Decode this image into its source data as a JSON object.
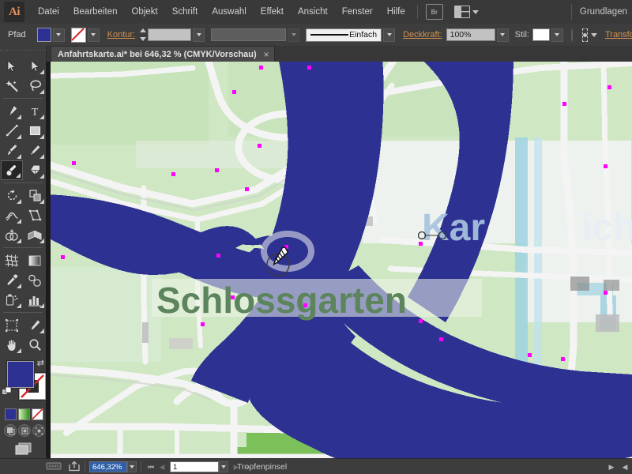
{
  "app": {
    "logo_text": "Ai",
    "workspace_name": "Grundlagen"
  },
  "menu": {
    "items": [
      {
        "label": "Datei"
      },
      {
        "label": "Bearbeiten"
      },
      {
        "label": "Objekt"
      },
      {
        "label": "Schrift"
      },
      {
        "label": "Auswahl"
      },
      {
        "label": "Effekt"
      },
      {
        "label": "Ansicht"
      },
      {
        "label": "Fenster"
      },
      {
        "label": "Hilfe"
      }
    ],
    "bridge_label": "Br"
  },
  "control_bar": {
    "object_label": "Pfad",
    "fill_color": "#2d3192",
    "stroke_none_label": "Ohne",
    "stroke_label": "Kontur:",
    "stroke_weight": "",
    "stroke_profile": "",
    "brush_label": "Einfach",
    "opacity_label": "Deckkraft:",
    "opacity_value": "100%",
    "style_label": "Stil:",
    "transform_label": "Transformieren"
  },
  "document_tab": {
    "title": "Anfahrtskarte.ai* bei 646,32 % (CMYK/Vorschau)",
    "close_glyph": "×"
  },
  "tools": {
    "items": [
      {
        "name": "selection-tool",
        "label": "Auswahlwerkzeug",
        "selected": false
      },
      {
        "name": "direct-selection-tool",
        "label": "Direktauswahl-Werkzeug",
        "selected": false
      },
      {
        "name": "magic-wand-tool",
        "label": "Zauberstab-Werkzeug",
        "selected": false
      },
      {
        "name": "lasso-tool",
        "label": "Lasso-Werkzeug",
        "selected": false
      },
      {
        "name": "pen-tool",
        "label": "Zeichenstift-Werkzeug",
        "selected": false
      },
      {
        "name": "type-tool",
        "label": "Text-Werkzeug",
        "selected": false
      },
      {
        "name": "line-segment-tool",
        "label": "Liniensegment-Werkzeug",
        "selected": false
      },
      {
        "name": "rectangle-tool",
        "label": "Rechteck-Werkzeug",
        "selected": false
      },
      {
        "name": "paintbrush-tool",
        "label": "Pinsel-Werkzeug",
        "selected": false
      },
      {
        "name": "pencil-tool",
        "label": "Buntstift-Werkzeug",
        "selected": false
      },
      {
        "name": "blob-brush-tool",
        "label": "Tropfenpinsel-Werkzeug",
        "selected": true
      },
      {
        "name": "eraser-tool",
        "label": "Radiergummi-Werkzeug",
        "selected": false
      },
      {
        "name": "rotate-tool",
        "label": "Drehen-Werkzeug",
        "selected": false
      },
      {
        "name": "scale-tool",
        "label": "Skalieren-Werkzeug",
        "selected": false
      },
      {
        "name": "width-tool",
        "label": "Breite-Werkzeug",
        "selected": false
      },
      {
        "name": "free-transform-tool",
        "label": "Frei-transformieren-Werkzeug",
        "selected": false
      },
      {
        "name": "shape-builder-tool",
        "label": "Formerstellungswerkzeug",
        "selected": false
      },
      {
        "name": "perspective-grid-tool",
        "label": "Perspektivenraster-Werkzeug",
        "selected": false
      },
      {
        "name": "mesh-tool",
        "label": "Gitter-Werkzeug",
        "selected": false
      },
      {
        "name": "gradient-tool",
        "label": "Verlauf-Werkzeug",
        "selected": false
      },
      {
        "name": "eyedropper-tool",
        "label": "Pipette-Werkzeug",
        "selected": false
      },
      {
        "name": "blend-tool",
        "label": "Angleichen-Werkzeug",
        "selected": false
      },
      {
        "name": "symbol-sprayer-tool",
        "label": "Symbol-aufsprühen-Werkzeug",
        "selected": false
      },
      {
        "name": "column-graph-tool",
        "label": "Säulendiagramm-Werkzeug",
        "selected": false
      },
      {
        "name": "artboard-tool",
        "label": "Zeichenflächen-Werkzeug",
        "selected": false
      },
      {
        "name": "slice-tool",
        "label": "Slice-Werkzeug",
        "selected": false
      },
      {
        "name": "hand-tool",
        "label": "Hand-Werkzeug",
        "selected": false
      },
      {
        "name": "zoom-tool",
        "label": "Zoom-Werkzeug",
        "selected": false
      }
    ],
    "fill_color": "#2d3192",
    "stroke_color": "none",
    "color_mode_swatches": [
      "#2d3192",
      "gradient",
      "none"
    ],
    "drawing_modes": [
      "draw-normal",
      "draw-behind",
      "draw-inside"
    ]
  },
  "canvas": {
    "map_labels": [
      {
        "text": "Schlossgarten",
        "color": "#5b7f5b"
      },
      {
        "text": "Kar",
        "color": "#9bb8d8"
      },
      {
        "text": "ich",
        "color": "#9bb8d8"
      }
    ],
    "water_color": "#2d3192",
    "park_color": "#cfe7c2",
    "dark_green_color": "#7cc05a",
    "road_color": "#f2f2f2",
    "anchor_color": "#ff00ff",
    "active_tool_cursor": "blob-brush-cursor"
  },
  "status_bar": {
    "zoom_value": "646,32%",
    "page_value": "1",
    "current_tool": "Tropfenpinsel"
  }
}
